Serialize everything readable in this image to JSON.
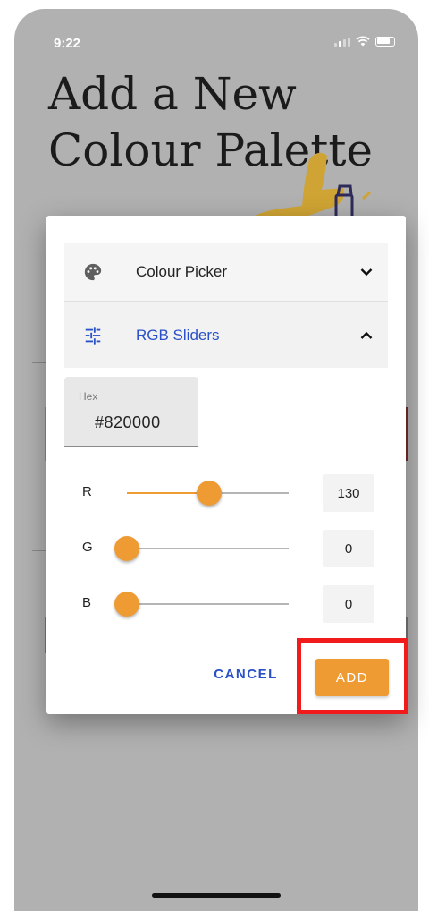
{
  "status_bar": {
    "time": "9:22"
  },
  "page": {
    "title": "Add a New Colour Palette"
  },
  "dialog": {
    "panels": [
      {
        "label": "Colour Picker",
        "icon": "palette-icon",
        "expanded": false
      },
      {
        "label": "RGB Sliders",
        "icon": "tune-icon",
        "expanded": true
      }
    ],
    "hex": {
      "label": "Hex",
      "value": "#820000"
    },
    "sliders": [
      {
        "channel": "R",
        "value": "130",
        "fraction": 0.51
      },
      {
        "channel": "G",
        "value": "0",
        "fraction": 0
      },
      {
        "channel": "B",
        "value": "0",
        "fraction": 0
      }
    ],
    "actions": {
      "cancel": "CANCEL",
      "add": "ADD"
    }
  },
  "colors": {
    "accent": "#ef9b34",
    "link": "#2a50c8",
    "highlight": "#f21b1b",
    "scrim": "#b1b1b1"
  }
}
